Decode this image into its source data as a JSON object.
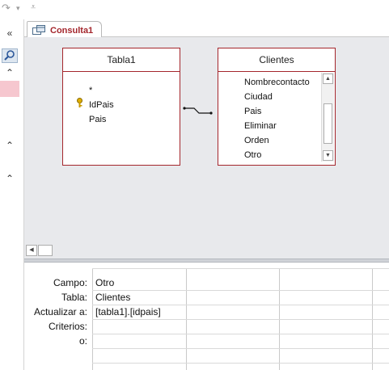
{
  "quick_access": {
    "undo_glyph": "↶",
    "redo_glyph": "↷",
    "customize_glyph": "⩡"
  },
  "nav": {
    "collapse_glyph": "«",
    "chevron_glyph": "⌃"
  },
  "tab": {
    "title": "Consulta1"
  },
  "tables": [
    {
      "name": "Tabla1",
      "fields": [
        "*",
        "IdPais",
        "Pais"
      ],
      "key_field": "IdPais"
    },
    {
      "name": "Clientes",
      "fields": [
        "Nombrecontacto",
        "Ciudad",
        "Pais",
        "Eliminar",
        "Orden",
        "Otro"
      ]
    }
  ],
  "grid": {
    "row_labels": [
      "Campo:",
      "Tabla:",
      "Actualizar a:",
      "Criterios:",
      "o:"
    ],
    "column1": [
      "Otro",
      "Clientes",
      "[tabla1].[idpais]",
      "",
      ""
    ]
  },
  "colors": {
    "accent": "#a4262c",
    "pane_bg": "#e8e9ec"
  }
}
